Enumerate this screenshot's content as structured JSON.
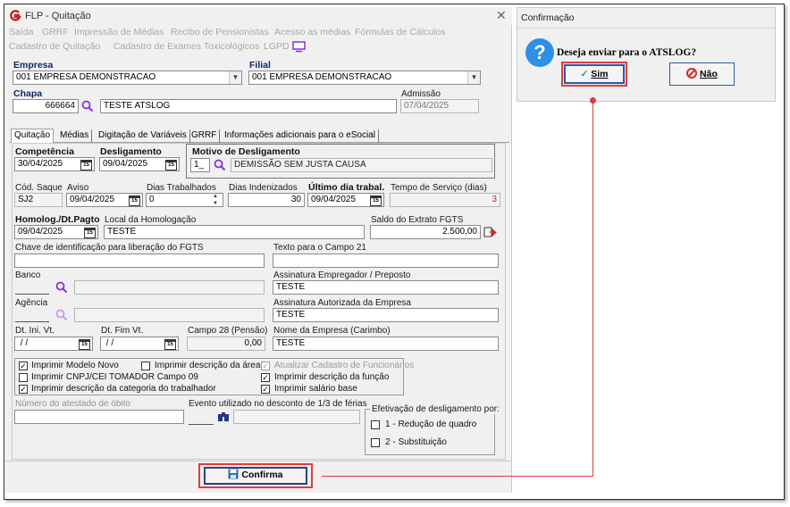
{
  "window": {
    "title": "FLP - Quitação",
    "close_glyph": "✕"
  },
  "menu": {
    "row1": [
      "Saída",
      "GRRF",
      "Impressão de Médias",
      "Recibo de Pensionistas",
      "Acesso as médias",
      "Fórmulas de Cálculos"
    ],
    "row2": [
      "Cadastro de Quitação",
      "Cadastro de Exames Toxicológicos",
      "LGPD"
    ]
  },
  "header": {
    "empresa_label": "Empresa",
    "empresa_value": "001 EMPRESA DEMONSTRACAO",
    "filial_label": "Filial",
    "filial_value": "001 EMPRESA DEMONSTRACAO",
    "chapa_label": "Chapa",
    "chapa_value": "666664",
    "nome_value": "TESTE ATSLOG",
    "admissao_label": "Admissão",
    "admissao_value": "07/04/2025"
  },
  "tabs": [
    {
      "label": "Quitação",
      "active": true
    },
    {
      "label": "Médias",
      "active": false
    },
    {
      "label": "Digitação de Variáveis",
      "active": false
    },
    {
      "label": "GRRF",
      "active": false
    },
    {
      "label": "Informações adicionais para o eSocial",
      "active": false
    }
  ],
  "form": {
    "competencia_label": "Competência",
    "competencia_value": "30/04/2025",
    "desligamento_label": "Desligamento",
    "desligamento_value": "09/04/2025",
    "motivo_label": "Motivo de Desligamento",
    "motivo_code": "1_",
    "motivo_value": "DEMISSÃO SEM JUSTA CAUSA",
    "cod_saque_label": "Cód. Saque",
    "cod_saque_value": "SJ2",
    "aviso_label": "Aviso",
    "aviso_value": "09/04/2025",
    "dias_trab_label": "Dias Trabalhados",
    "dias_trab_value": "0",
    "dias_indenizados_label": "Dias Indenizados",
    "dias_indenizados_value": "30",
    "ultimo_dia_label": "Último dia trabal.",
    "ultimo_dia_value": "09/04/2025",
    "tempo_servico_label": "Tempo de Serviço (dias)",
    "tempo_servico_value": "3",
    "homolog_label": "Homolog./Dt.Pagto",
    "homolog_value": "09/04/2025",
    "local_homolog_label": "Local da Homologação",
    "local_homolog_value": "TESTE",
    "saldo_label": "Saldo do Extrato FGTS",
    "saldo_value": "2.500,00",
    "chave_label": "Chave de identificação para liberação do FGTS",
    "chave_value": "",
    "texto21_label": "Texto para o Campo 21",
    "texto21_value": "",
    "banco_label": "Banco",
    "banco_value": "",
    "assin_emp_label": "Assinatura Empregador / Preposto",
    "assin_emp_value": "TESTE",
    "agencia_label": "Agência",
    "agencia_value": "",
    "assin_aut_label": "Assinatura Autorizada da Empresa",
    "assin_aut_value": "TESTE",
    "dt_ini_label": "Dt. Ini. Vt.",
    "dt_ini_value": " / /",
    "dt_fim_label": "Dt. Fim Vt.",
    "dt_fim_value": " / /",
    "campo28_label": "Campo 28 (Pensão)",
    "campo28_value": "0,00",
    "nome_emp_label": "Nome da Empresa (Carimbo)",
    "nome_emp_value": "TESTE",
    "obito_label": "Número do atestado de óbito",
    "evento_label": "Evento utilizado no desconto de 1/3 de férias",
    "efetivacao_label": "Efetivação de desligamento por:"
  },
  "checkboxes": [
    {
      "label": "Imprimir Modelo Novo",
      "checked": true,
      "enabled": true
    },
    {
      "label": "Imprimir descrição da área",
      "checked": false,
      "enabled": true
    },
    {
      "label": "Atualizar Cadastro de Funcionários",
      "checked": true,
      "enabled": false
    },
    {
      "label": "Imprimir CNPJ/CEI TOMADOR Campo 09",
      "checked": false,
      "enabled": true
    },
    {
      "label": "Imprimir descrição da função",
      "checked": true,
      "enabled": true
    },
    {
      "label": "Imprimir descrição da categoria do trabalhador",
      "checked": true,
      "enabled": true
    },
    {
      "label": "Imprimir salário base",
      "checked": true,
      "enabled": true
    },
    {
      "label": "1 - Redução de quadro",
      "checked": false,
      "enabled": true
    },
    {
      "label": "2 - Substituição",
      "checked": false,
      "enabled": true
    }
  ],
  "confirm_button": "Confirma",
  "dialog": {
    "title": "Confirmação",
    "message": "Deseja enviar para o ATSLOG?",
    "yes": "Sim",
    "no": "Não",
    "question_glyph": "?"
  },
  "colors": {
    "highlight": "#e23b3b",
    "label_blue": "#0b2a66",
    "question_blue": "#2f8ee5"
  }
}
